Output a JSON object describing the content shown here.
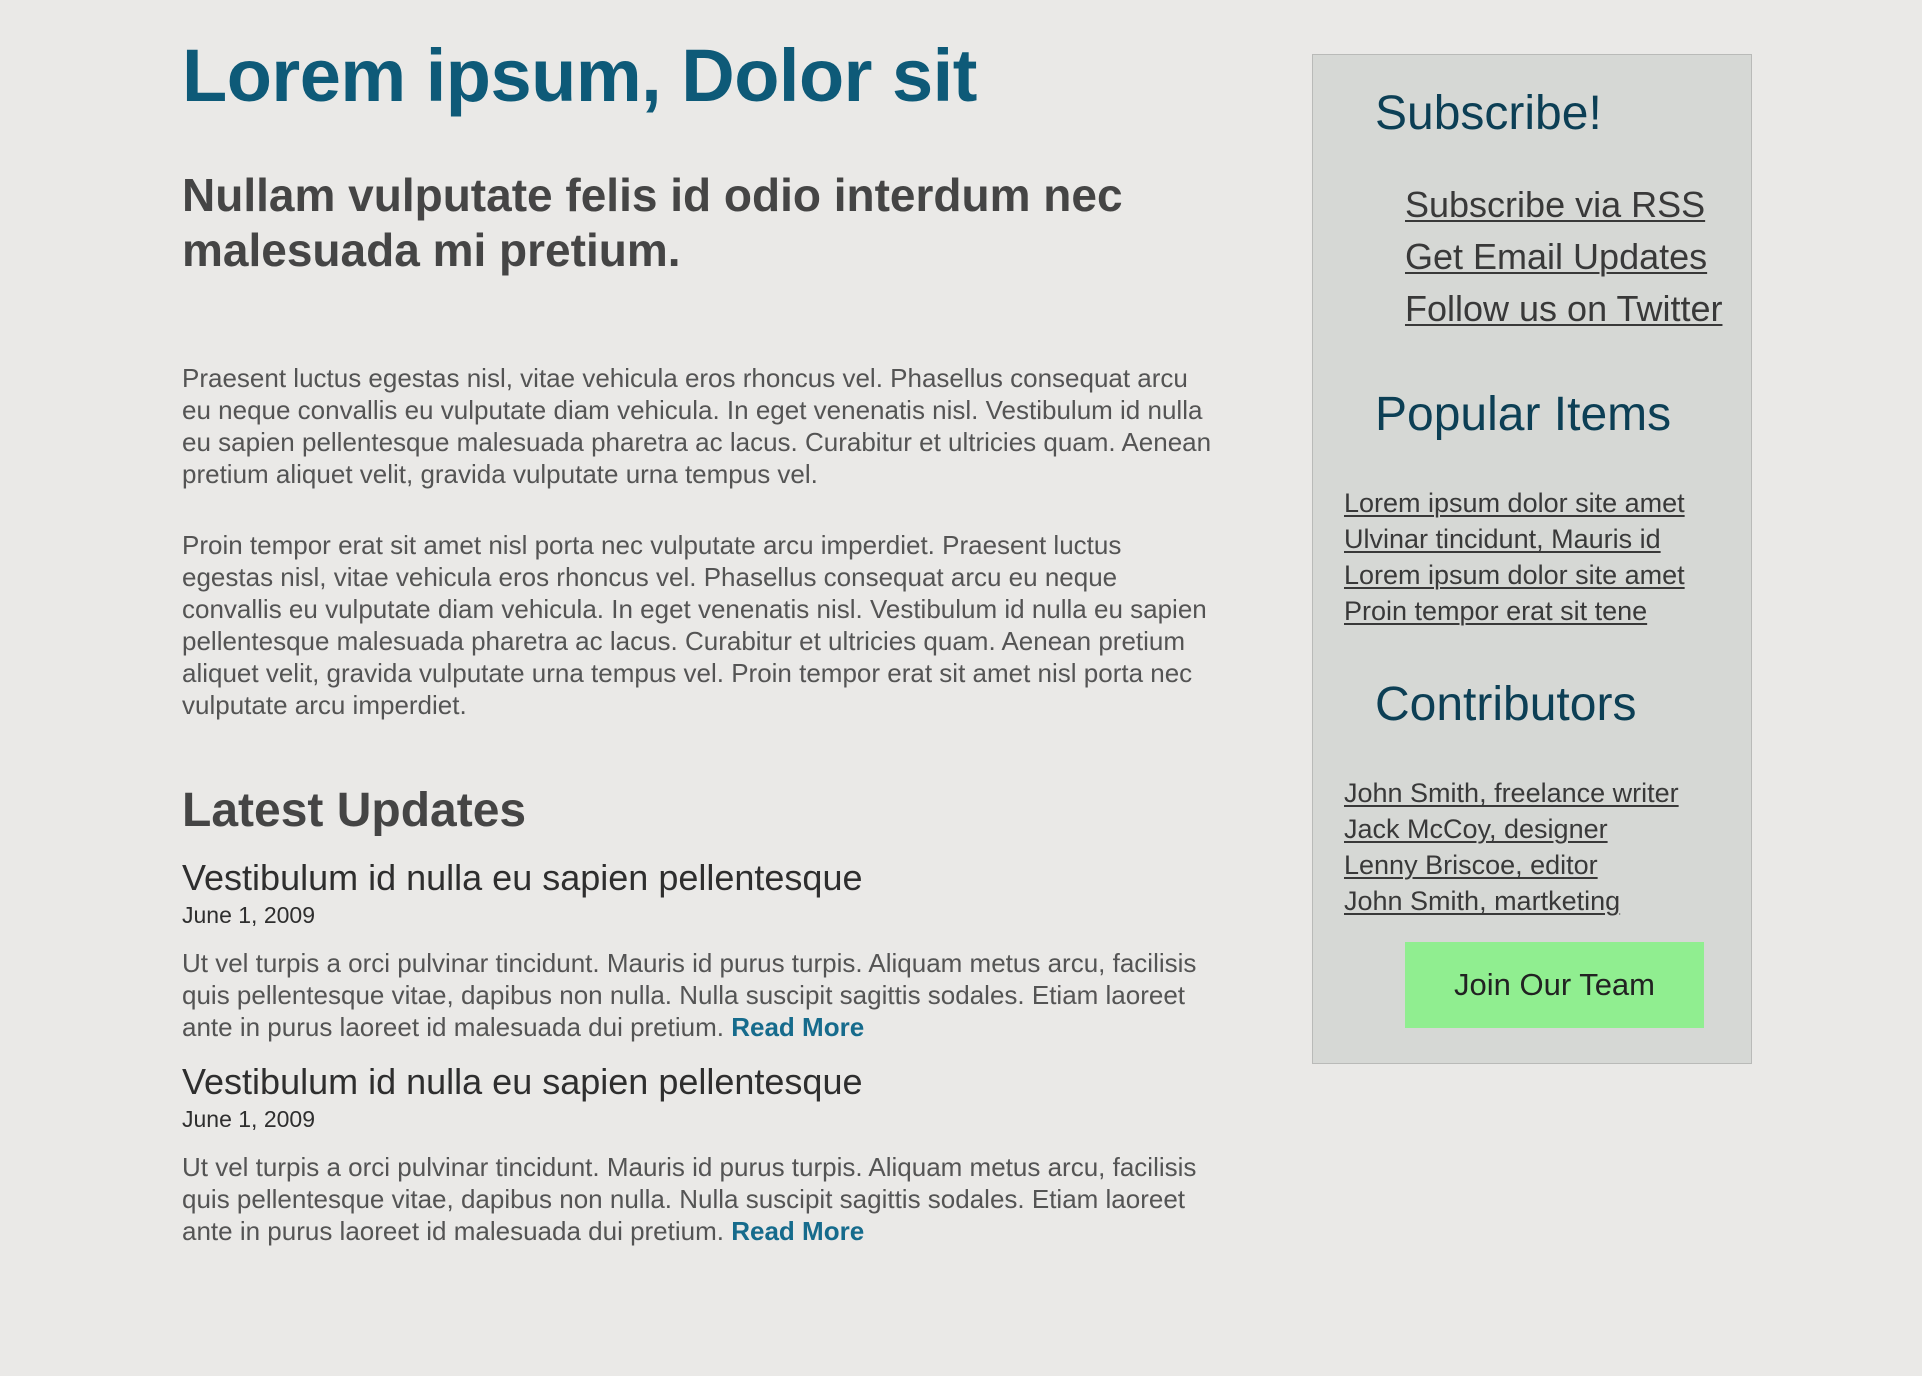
{
  "main": {
    "title": "Lorem ipsum, Dolor sit",
    "subtitle": "Nullam vulputate felis id odio interdum nec malesuada mi pretium.",
    "paragraphs": [
      "Praesent luctus egestas nisl, vitae vehicula eros rhoncus vel. Phasellus consequat arcu eu neque convallis eu vulputate diam vehicula. In eget venenatis nisl. Vestibulum id nulla eu sapien pellentesque malesuada pharetra ac lacus. Curabitur et ultricies quam. Aenean pretium aliquet velit, gravida vulputate urna tempus vel.",
      "Proin tempor erat sit amet nisl porta nec vulputate arcu imperdiet. Praesent luctus egestas nisl, vitae vehicula eros rhoncus vel. Phasellus consequat arcu eu neque convallis eu vulputate diam vehicula. In eget venenatis nisl. Vestibulum id nulla eu sapien pellentesque malesuada pharetra ac lacus. Curabitur et ultricies quam. Aenean pretium aliquet velit, gravida vulputate urna tempus vel. Proin tempor erat sit amet nisl porta nec vulputate arcu imperdiet."
    ],
    "updates_heading": "Latest Updates",
    "updates": [
      {
        "title": "Vestibulum id nulla eu sapien pellentesque",
        "date": "June 1, 2009",
        "body": "Ut vel turpis a orci pulvinar tincidunt. Mauris id purus turpis. Aliquam metus arcu, facilisis quis pellentesque vitae, dapibus non nulla. Nulla suscipit sagittis sodales. Etiam laoreet ante in purus laoreet id malesuada dui pretium.",
        "read_more": "Read More"
      },
      {
        "title": "Vestibulum id nulla eu sapien pellentesque",
        "date": "June 1, 2009",
        "body": "Ut vel turpis a orci pulvinar tincidunt. Mauris id purus turpis. Aliquam metus arcu, facilisis quis pellentesque vitae, dapibus non nulla. Nulla suscipit sagittis sodales. Etiam laoreet ante in purus laoreet id malesuada dui pretium.",
        "read_more": "Read More"
      }
    ]
  },
  "sidebar": {
    "subscribe": {
      "heading": "Subscribe!",
      "links": [
        "Subscribe via RSS",
        "Get Email Updates",
        "Follow us on Twitter"
      ]
    },
    "popular": {
      "heading": "Popular Items",
      "links": [
        "Lorem ipsum dolor site amet",
        "Ulvinar tincidunt, Mauris id",
        "Lorem ipsum dolor site amet",
        "Proin tempor erat sit tene"
      ]
    },
    "contributors": {
      "heading": "Contributors",
      "links": [
        "John Smith, freelance writer",
        "Jack McCoy, designer",
        "Lenny Briscoe, editor",
        "John Smith, martketing"
      ]
    },
    "join_button": "Join Our Team"
  },
  "colors": {
    "page_background": "#eae9e7",
    "title": "#0e5a78",
    "sidebar_background": "#d6d8d5",
    "sidebar_heading": "#0c3f55",
    "read_more_link": "#166b8c",
    "join_button": "#90ee90"
  }
}
